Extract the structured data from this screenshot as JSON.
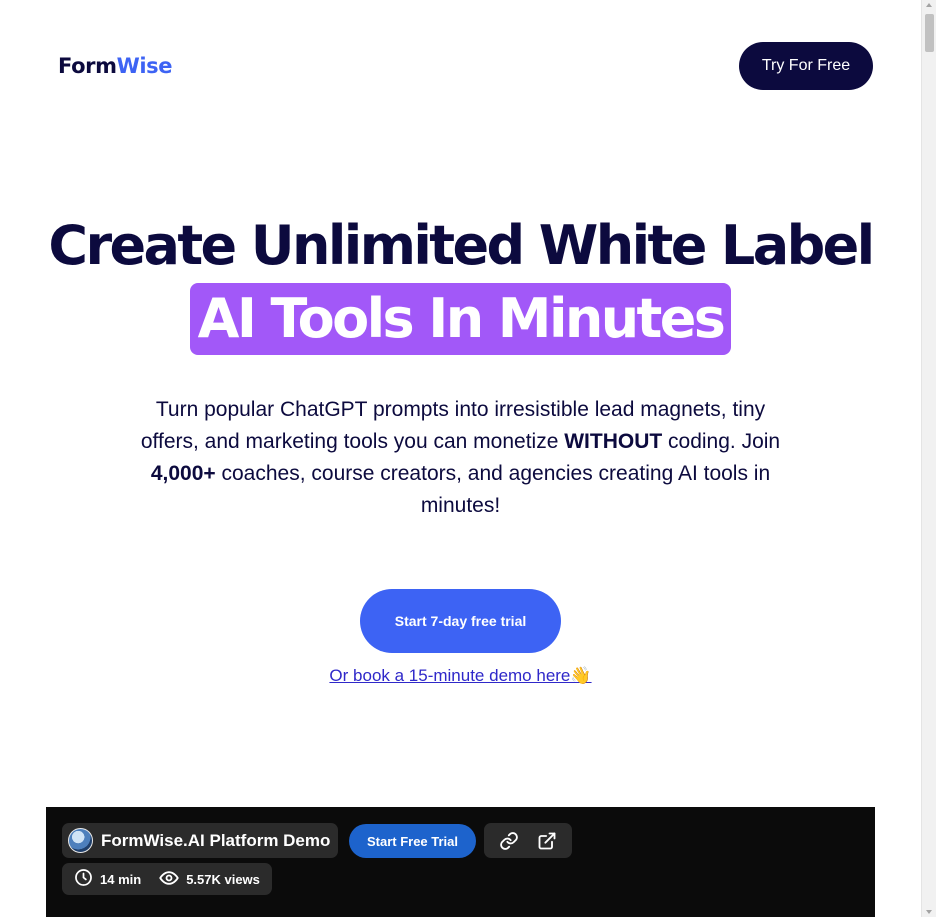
{
  "brand": {
    "logo_part1": "Form",
    "logo_part2": "Wise",
    "primary_color": "#0c0a3e",
    "accent_color": "#3d63f4",
    "highlight_color": "#a258f8"
  },
  "nav": {
    "cta_label": "Try For Free"
  },
  "hero": {
    "headline_line1": "Create Unlimited White Label",
    "headline_highlight": "AI Tools In Minutes",
    "sub_part1": "Turn popular ChatGPT prompts into irresistible lead magnets, tiny offers, and marketing tools you can monetize ",
    "sub_bold1": "WITHOUT",
    "sub_part2": " coding. Join ",
    "sub_bold2": "4,000+",
    "sub_part3": " coaches, course creators, and agencies creating AI tools in minutes!",
    "primary_cta": "Start 7-day free trial",
    "demo_link": "Or book a 15-minute demo here👋"
  },
  "video": {
    "title": "FormWise.AI Platform Demo",
    "cta_label": "Start Free Trial",
    "duration": "14 min",
    "views": "5.57K views",
    "icons": [
      "link-icon",
      "external-link-icon",
      "clock-icon",
      "eye-icon"
    ]
  }
}
